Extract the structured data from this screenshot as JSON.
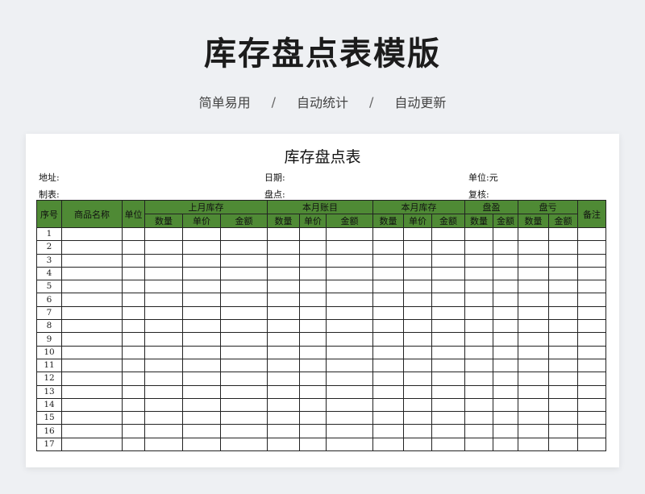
{
  "page": {
    "title": "库存盘点表模版",
    "features": [
      "简单易用",
      "自动统计",
      "自动更新"
    ],
    "separator": "/"
  },
  "sheet": {
    "title": "库存盘点表",
    "address_label": "地址:",
    "date_label": "日期:",
    "unit_label": "单位:元",
    "maker_label": "制表:",
    "counter_label": "盘点:",
    "reviewer_label": "复核:"
  },
  "table": {
    "headers": {
      "seq": "序号",
      "name": "商品名称",
      "unit": "单位",
      "last_month_stock": "上月库存",
      "this_month_book": "本月账目",
      "this_month_stock": "本月库存",
      "surplus": "盘盈",
      "loss": "盘亏",
      "remarks": "备注",
      "qty": "数量",
      "price": "单价",
      "amount": "金额"
    },
    "row_numbers": [
      "1",
      "2",
      "3",
      "4",
      "5",
      "6",
      "7",
      "8",
      "9",
      "10",
      "11",
      "12",
      "13",
      "14",
      "15",
      "16",
      "17"
    ]
  }
}
